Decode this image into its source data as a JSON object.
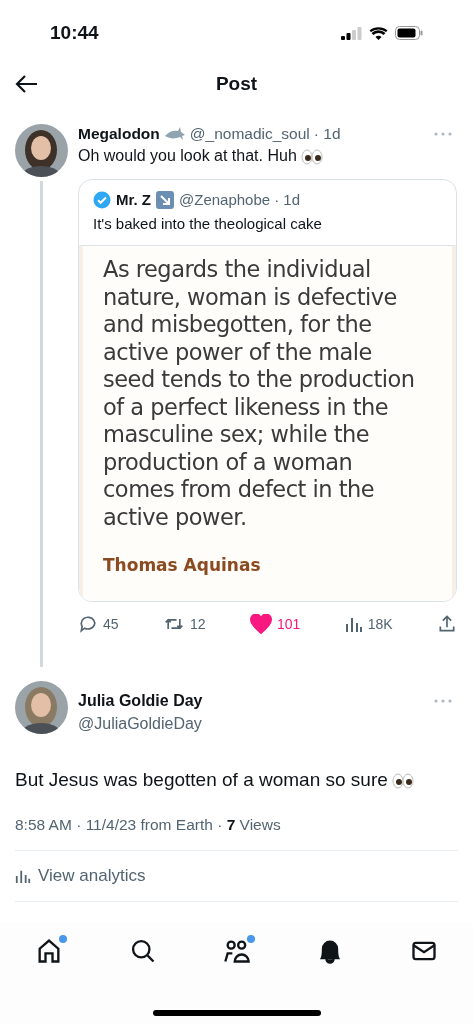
{
  "status_bar": {
    "time": "10:44"
  },
  "header": {
    "title": "Post"
  },
  "parent_post": {
    "name": "Megalodon",
    "handle": "@_nomadic_soul",
    "time": "· 1d",
    "text": "Oh would you look at that. Huh",
    "quote": {
      "name": "Mr. Z",
      "verified": true,
      "handle": "@Zenaphobe",
      "time": "· 1d",
      "text": "It's baked into the theological cake",
      "image_quote": "As regards the individual nature, woman is defective and misbegotten, for the active power of the male seed tends to the production of a perfect likeness in the masculine sex; while the production of a woman comes from defect in the active power.",
      "image_author": "Thomas Aquinas"
    },
    "actions": [
      {
        "kind": "reply",
        "count": "45",
        "selected": false
      },
      {
        "kind": "repost",
        "count": "12",
        "selected": false
      },
      {
        "kind": "like",
        "count": "101",
        "selected": true
      },
      {
        "kind": "views",
        "count": "18K",
        "selected": false
      },
      {
        "kind": "share",
        "selected": false
      }
    ]
  },
  "reply_post": {
    "name": "Julia Goldie Day",
    "handle": "@JuliaGoldieDay",
    "text": "But Jesus was begotten of a woman so sure",
    "meta": "8:58 AM · 11/4/23 from Earth · **7** Views",
    "analytics": "View analytics"
  },
  "tab_bar": [
    {
      "kind": "home",
      "badge": true
    },
    {
      "kind": "search",
      "badge": false
    },
    {
      "kind": "communities",
      "badge": true
    },
    {
      "kind": "notifications",
      "badge": false
    },
    {
      "kind": "messages",
      "badge": false
    }
  ]
}
